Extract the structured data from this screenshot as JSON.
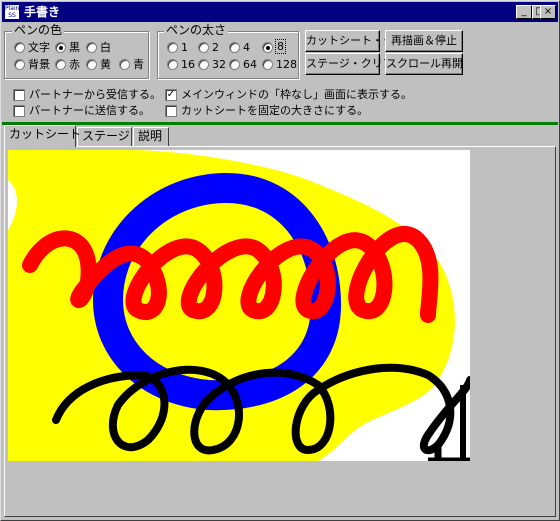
{
  "window": {
    "title": "手書き",
    "icon_text": "Plain SS"
  },
  "titlebar_buttons": [
    "_",
    "□",
    "×"
  ],
  "pen_color": {
    "legend": "ペンの色",
    "options": [
      "文字",
      "黒",
      "白",
      "背景",
      "赤",
      "黄",
      "青"
    ],
    "selected": "黒"
  },
  "pen_width": {
    "legend": "ペンの太さ",
    "options": [
      "1",
      "2",
      "4",
      "8",
      "16",
      "32",
      "64",
      "128"
    ],
    "selected": "8"
  },
  "buttons": {
    "cut_clear": "カットシート・クリア",
    "redraw_stop": "再描画＆停止",
    "stage_clear": "ステージ・クリア",
    "scroll_resume": "スクロール再開"
  },
  "checkboxes": {
    "receive_partner": {
      "label": "パートナーから受信する。",
      "checked": false
    },
    "show_main_window": {
      "label": "メインウィンドの「枠なし」画面に表示する。",
      "checked": true
    },
    "send_partner": {
      "label": "パートナーに送信する。",
      "checked": false
    },
    "fix_cut_size": {
      "label": "カットシートを固定の大きさにする。",
      "checked": false
    }
  },
  "tabs": [
    "カットシート",
    "ステージ",
    "説明"
  ],
  "active_tab": "カットシート",
  "colors": {
    "yellow": "#ffff00",
    "blue": "#0000ff",
    "red": "#ff0000",
    "black": "#000000",
    "titlebar": "#000080",
    "separator": "#008000"
  }
}
